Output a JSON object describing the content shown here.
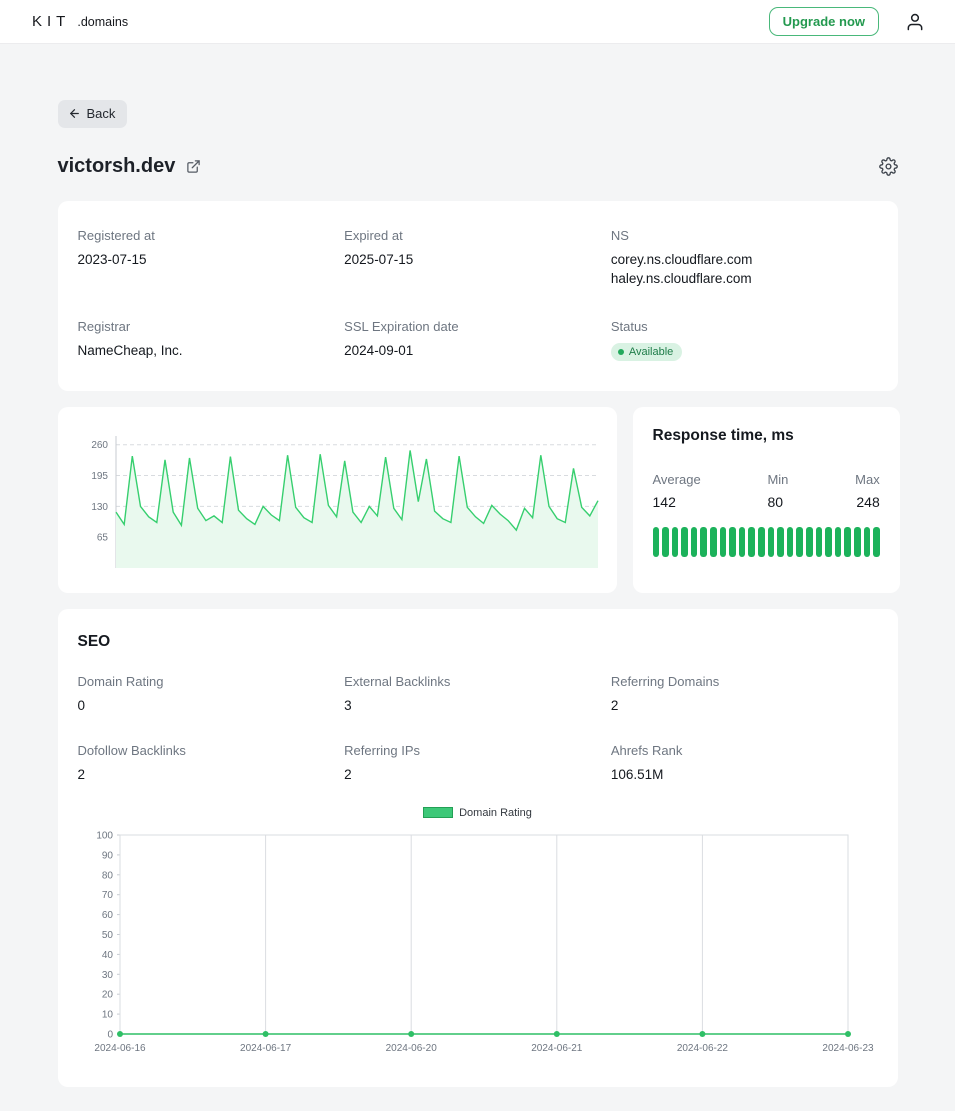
{
  "header": {
    "logo_primary": "KIT",
    "logo_secondary": ".domains",
    "upgrade_label": "Upgrade now"
  },
  "page": {
    "back_label": "Back",
    "title": "victorsh.dev"
  },
  "domain_info": {
    "registered": {
      "label": "Registered at",
      "value": "2023-07-15"
    },
    "expired": {
      "label": "Expired at",
      "value": "2025-07-15"
    },
    "ns": {
      "label": "NS",
      "lines": [
        "corey.ns.cloudflare.com",
        "haley.ns.cloudflare.com"
      ]
    },
    "registrar": {
      "label": "Registrar",
      "value": "NameCheap, Inc."
    },
    "ssl": {
      "label": "SSL Expiration date",
      "value": "2024-09-01"
    },
    "status": {
      "label": "Status",
      "value": "Available"
    }
  },
  "response_time": {
    "title": "Response time, ms",
    "average": {
      "label": "Average",
      "value": "142"
    },
    "min": {
      "label": "Min",
      "value": "80"
    },
    "max": {
      "label": "Max",
      "value": "248"
    },
    "bar_count": 24
  },
  "seo": {
    "title": "SEO",
    "metrics": [
      {
        "label": "Domain Rating",
        "value": "0"
      },
      {
        "label": "External Backlinks",
        "value": "3"
      },
      {
        "label": "Referring Domains",
        "value": "2"
      },
      {
        "label": "Dofollow Backlinks",
        "value": "2"
      },
      {
        "label": "Referring IPs",
        "value": "2"
      },
      {
        "label": "Ahrefs Rank",
        "value": "106.51M"
      }
    ]
  },
  "colors": {
    "accent_green": "#23994f",
    "line_green": "#37cf6f",
    "area_green": "#e9f9ee",
    "badge_bg": "#d9f2e3",
    "badge_text": "#1e7c49"
  },
  "chart_data": [
    {
      "type": "line",
      "name": "response-time-history",
      "ylabel": "ms",
      "ylim": [
        0,
        270
      ],
      "yticks": [
        65,
        130,
        195,
        260
      ],
      "grid": "dashed-horizontal",
      "legend_position": "none",
      "values": [
        118,
        92,
        236,
        130,
        108,
        96,
        228,
        118,
        90,
        232,
        126,
        100,
        110,
        96,
        235,
        122,
        104,
        92,
        130,
        112,
        100,
        238,
        128,
        106,
        96,
        240,
        132,
        108,
        226,
        118,
        96,
        130,
        110,
        234,
        126,
        102,
        248,
        140,
        230,
        120,
        104,
        96,
        236,
        128,
        108,
        94,
        132,
        114,
        100,
        80,
        126,
        106,
        238,
        130,
        104,
        96,
        210,
        128,
        110,
        142
      ]
    },
    {
      "type": "line",
      "name": "domain-rating-history",
      "title": "Domain Rating",
      "legend": [
        "Domain Rating"
      ],
      "legend_position": "top-center",
      "categories": [
        "2024-06-16",
        "2024-06-17",
        "2024-06-20",
        "2024-06-21",
        "2024-06-22",
        "2024-06-23"
      ],
      "values": [
        0,
        0,
        0,
        0,
        0,
        0
      ],
      "ylim": [
        0,
        100
      ],
      "ytick_step": 10,
      "grid": "vertical"
    }
  ]
}
